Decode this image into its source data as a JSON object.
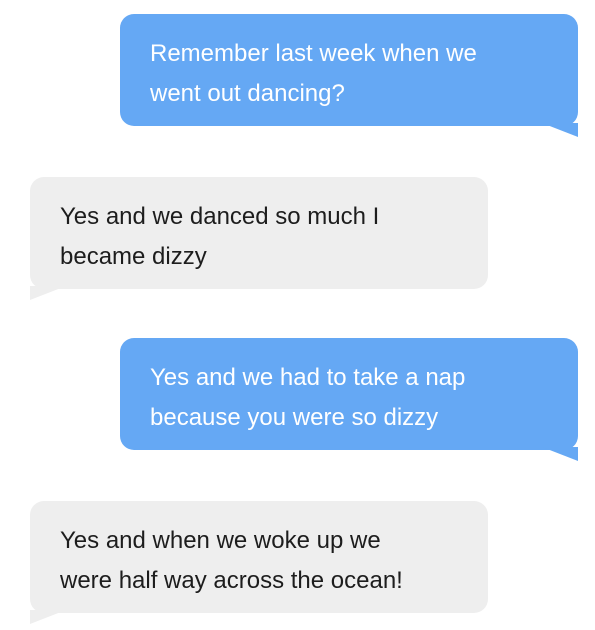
{
  "conversation": {
    "messages": [
      {
        "direction": "outgoing",
        "text": "Remember last week when we\nwent out dancing?"
      },
      {
        "direction": "incoming",
        "text": "Yes and we danced so much I\nbecame dizzy"
      },
      {
        "direction": "outgoing",
        "text": "Yes and we had to take a nap\nbecause you were so dizzy"
      },
      {
        "direction": "incoming",
        "text": "Yes and when we woke up we\nwere half way across the ocean!"
      }
    ]
  },
  "colors": {
    "outgoing_bubble": "#65a8f4",
    "incoming_bubble": "#eeeeee",
    "outgoing_text": "#ffffff",
    "incoming_text": "#1d1d1d",
    "background": "#ffffff"
  }
}
